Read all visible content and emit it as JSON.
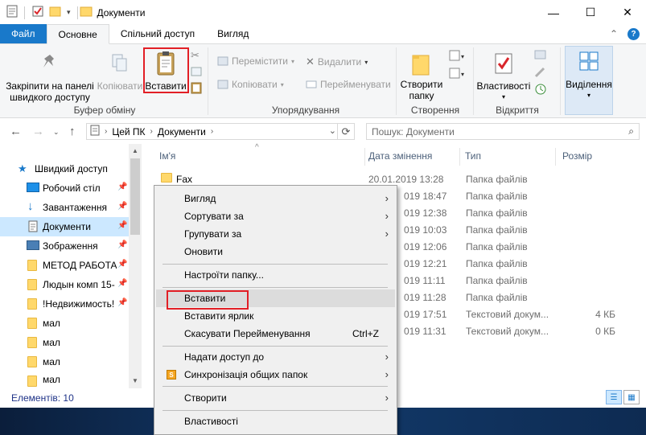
{
  "window": {
    "title": "Документи",
    "minimize": "—",
    "maximize": "☐",
    "close": "✕"
  },
  "tabs": [
    {
      "label": "Файл"
    },
    {
      "label": "Основне"
    },
    {
      "label": "Спільний доступ"
    },
    {
      "label": "Вигляд"
    }
  ],
  "ribbon": {
    "pin_label": "Закріпити на панелі швидкого доступу",
    "copy_label": "Копіювати",
    "paste_label": "Вставити",
    "move_label": "Перемістити",
    "copy_to_label": "Копіювати",
    "delete_label": "Видалити",
    "rename_label": "Перейменувати",
    "new_folder_label": "Створити папку",
    "properties_label": "Властивості",
    "select_label": "Виділення",
    "groups": {
      "clipboard": "Буфер обміну",
      "organize": "Упорядкування",
      "new": "Створення",
      "open": "Відкриття"
    }
  },
  "address": {
    "path": [
      "Цей ПК",
      "Документи"
    ],
    "search_placeholder": "Пошук: Документи"
  },
  "sidebar": {
    "items": [
      {
        "label": "Швидкий доступ"
      },
      {
        "label": "Робочий стіл"
      },
      {
        "label": "Завантаження"
      },
      {
        "label": "Документи"
      },
      {
        "label": "Зображення"
      },
      {
        "label": "МЕТОД РАБОТА"
      },
      {
        "label": "Людын комп 15-"
      },
      {
        "label": "!Недвижимость!"
      },
      {
        "label": "мал"
      },
      {
        "label": "мал"
      },
      {
        "label": "мал"
      },
      {
        "label": "мал"
      }
    ]
  },
  "columns": {
    "name": "Ім'я",
    "date": "Дата змінення",
    "type": "Тип",
    "size": "Розмір"
  },
  "files": [
    {
      "name": "Fax",
      "date": "20.01.2019 13:28",
      "type": "Папка файлів",
      "size": ""
    },
    {
      "name": "",
      "date": "019 18:47",
      "type": "Папка файлів",
      "size": ""
    },
    {
      "name": "",
      "date": "019 12:38",
      "type": "Папка файлів",
      "size": ""
    },
    {
      "name": "",
      "date": "019 10:03",
      "type": "Папка файлів",
      "size": ""
    },
    {
      "name": "",
      "date": "019 12:06",
      "type": "Папка файлів",
      "size": ""
    },
    {
      "name": "",
      "date": "019 12:21",
      "type": "Папка файлів",
      "size": ""
    },
    {
      "name": "",
      "date": "019 11:11",
      "type": "Папка файлів",
      "size": ""
    },
    {
      "name": "",
      "date": "019 11:28",
      "type": "Папка файлів",
      "size": ""
    },
    {
      "name": "",
      "date": "019 17:51",
      "type": "Текстовий докум...",
      "size": "4 КБ"
    },
    {
      "name": "",
      "date": "019 11:31",
      "type": "Текстовий докум...",
      "size": "0 КБ"
    }
  ],
  "status": {
    "count": "Елементів: 10"
  },
  "context_menu": {
    "view": "Вигляд",
    "sort_by": "Сортувати за",
    "group_by": "Групувати за",
    "refresh": "Оновити",
    "customize": "Настроїти папку...",
    "paste": "Вставити",
    "paste_shortcut": "Вставити ярлик",
    "undo_rename": "Скасувати Перейменування",
    "undo_shortcut": "Ctrl+Z",
    "share_with": "Надати доступ до",
    "sync": "Синхронізація общих папок",
    "new": "Створити",
    "properties": "Властивості"
  },
  "colors": {
    "accent": "#1979ca",
    "selection": "#cce8ff",
    "highlight_box": "#e21f26"
  }
}
